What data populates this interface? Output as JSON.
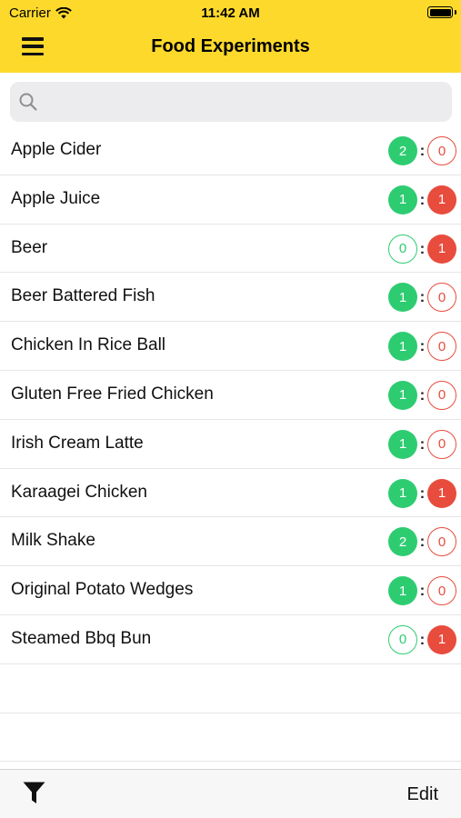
{
  "status_bar": {
    "carrier": "Carrier",
    "time": "11:42 AM"
  },
  "header": {
    "title": "Food Experiments",
    "menu_icon": "hamburger-menu-icon"
  },
  "search": {
    "placeholder": "",
    "value": "",
    "icon": "search-icon"
  },
  "colors": {
    "accent": "#fdd92c",
    "positive": "#2ecc71",
    "negative": "#e84c3d"
  },
  "items": [
    {
      "name": "Apple Cider",
      "good": "2",
      "bad": "0"
    },
    {
      "name": "Apple Juice",
      "good": "1",
      "bad": "1"
    },
    {
      "name": "Beer",
      "good": "0",
      "bad": "1"
    },
    {
      "name": "Beer Battered Fish",
      "good": "1",
      "bad": "0"
    },
    {
      "name": "Chicken In Rice Ball",
      "good": "1",
      "bad": "0"
    },
    {
      "name": "Gluten Free Fried Chicken",
      "good": "1",
      "bad": "0"
    },
    {
      "name": "Irish Cream Latte",
      "good": "1",
      "bad": "0"
    },
    {
      "name": "Karaagei Chicken",
      "good": "1",
      "bad": "1"
    },
    {
      "name": "Milk Shake",
      "good": "2",
      "bad": "0"
    },
    {
      "name": "Original Potato Wedges",
      "good": "1",
      "bad": "0"
    },
    {
      "name": "Steamed Bbq Bun",
      "good": "0",
      "bad": "1"
    }
  ],
  "score_separator": ":",
  "toolbar": {
    "filter_icon": "filter-icon",
    "edit_label": "Edit"
  }
}
